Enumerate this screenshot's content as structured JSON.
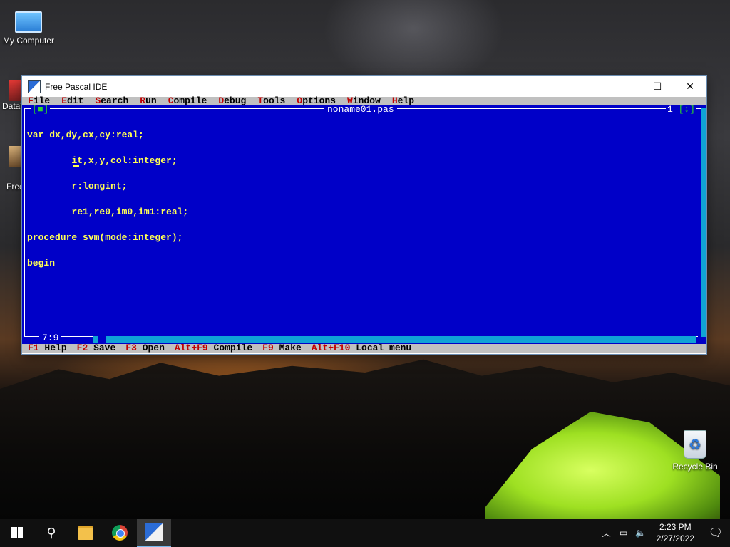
{
  "desktop": {
    "icons": [
      {
        "label": "My Computer"
      },
      {
        "label": "DataV"
      },
      {
        "label": "Free"
      },
      {
        "label": "Recycle Bin"
      }
    ]
  },
  "window": {
    "title": "Free Pascal IDE",
    "controls": {
      "minimize": "—",
      "maximize": "☐",
      "close": "✕"
    }
  },
  "menu": [
    {
      "hotkey": "F",
      "rest": "ile"
    },
    {
      "hotkey": "E",
      "rest": "dit"
    },
    {
      "hotkey": "S",
      "rest": "earch"
    },
    {
      "hotkey": "R",
      "rest": "un"
    },
    {
      "hotkey": "C",
      "rest": "ompile"
    },
    {
      "hotkey": "D",
      "rest": "ebug"
    },
    {
      "hotkey": "T",
      "rest": "ools"
    },
    {
      "hotkey": "O",
      "rest": "ptions"
    },
    {
      "hotkey": "W",
      "rest": "indow"
    },
    {
      "hotkey": "H",
      "rest": "elp"
    }
  ],
  "editor": {
    "filename": "noname01.pas",
    "close_box": "[■]",
    "window_number": "1",
    "zoom_box": "[↕]",
    "code_lines": [
      "var dx,dy,cx,cy:real;",
      "        it,x,y,col:integer;",
      "        r:longint;",
      "        re1,re0,im0,im1:real;",
      "procedure svm(mode:integer);",
      "begin"
    ],
    "cursor_position": "7:9"
  },
  "statusbar": [
    {
      "key": "F1",
      "label": "Help"
    },
    {
      "key": "F2",
      "label": "Save"
    },
    {
      "key": "F3",
      "label": "Open"
    },
    {
      "key": "Alt+F9",
      "label": "Compile"
    },
    {
      "key": "F9",
      "label": "Make"
    },
    {
      "key": "Alt+F10",
      "label": "Local menu"
    }
  ],
  "taskbar": {
    "time": "2:23 PM",
    "date": "2/27/2022",
    "icons": [
      "start-icon",
      "search-icon",
      "file-explorer-icon",
      "chrome-icon",
      "free-pascal-icon"
    ]
  }
}
